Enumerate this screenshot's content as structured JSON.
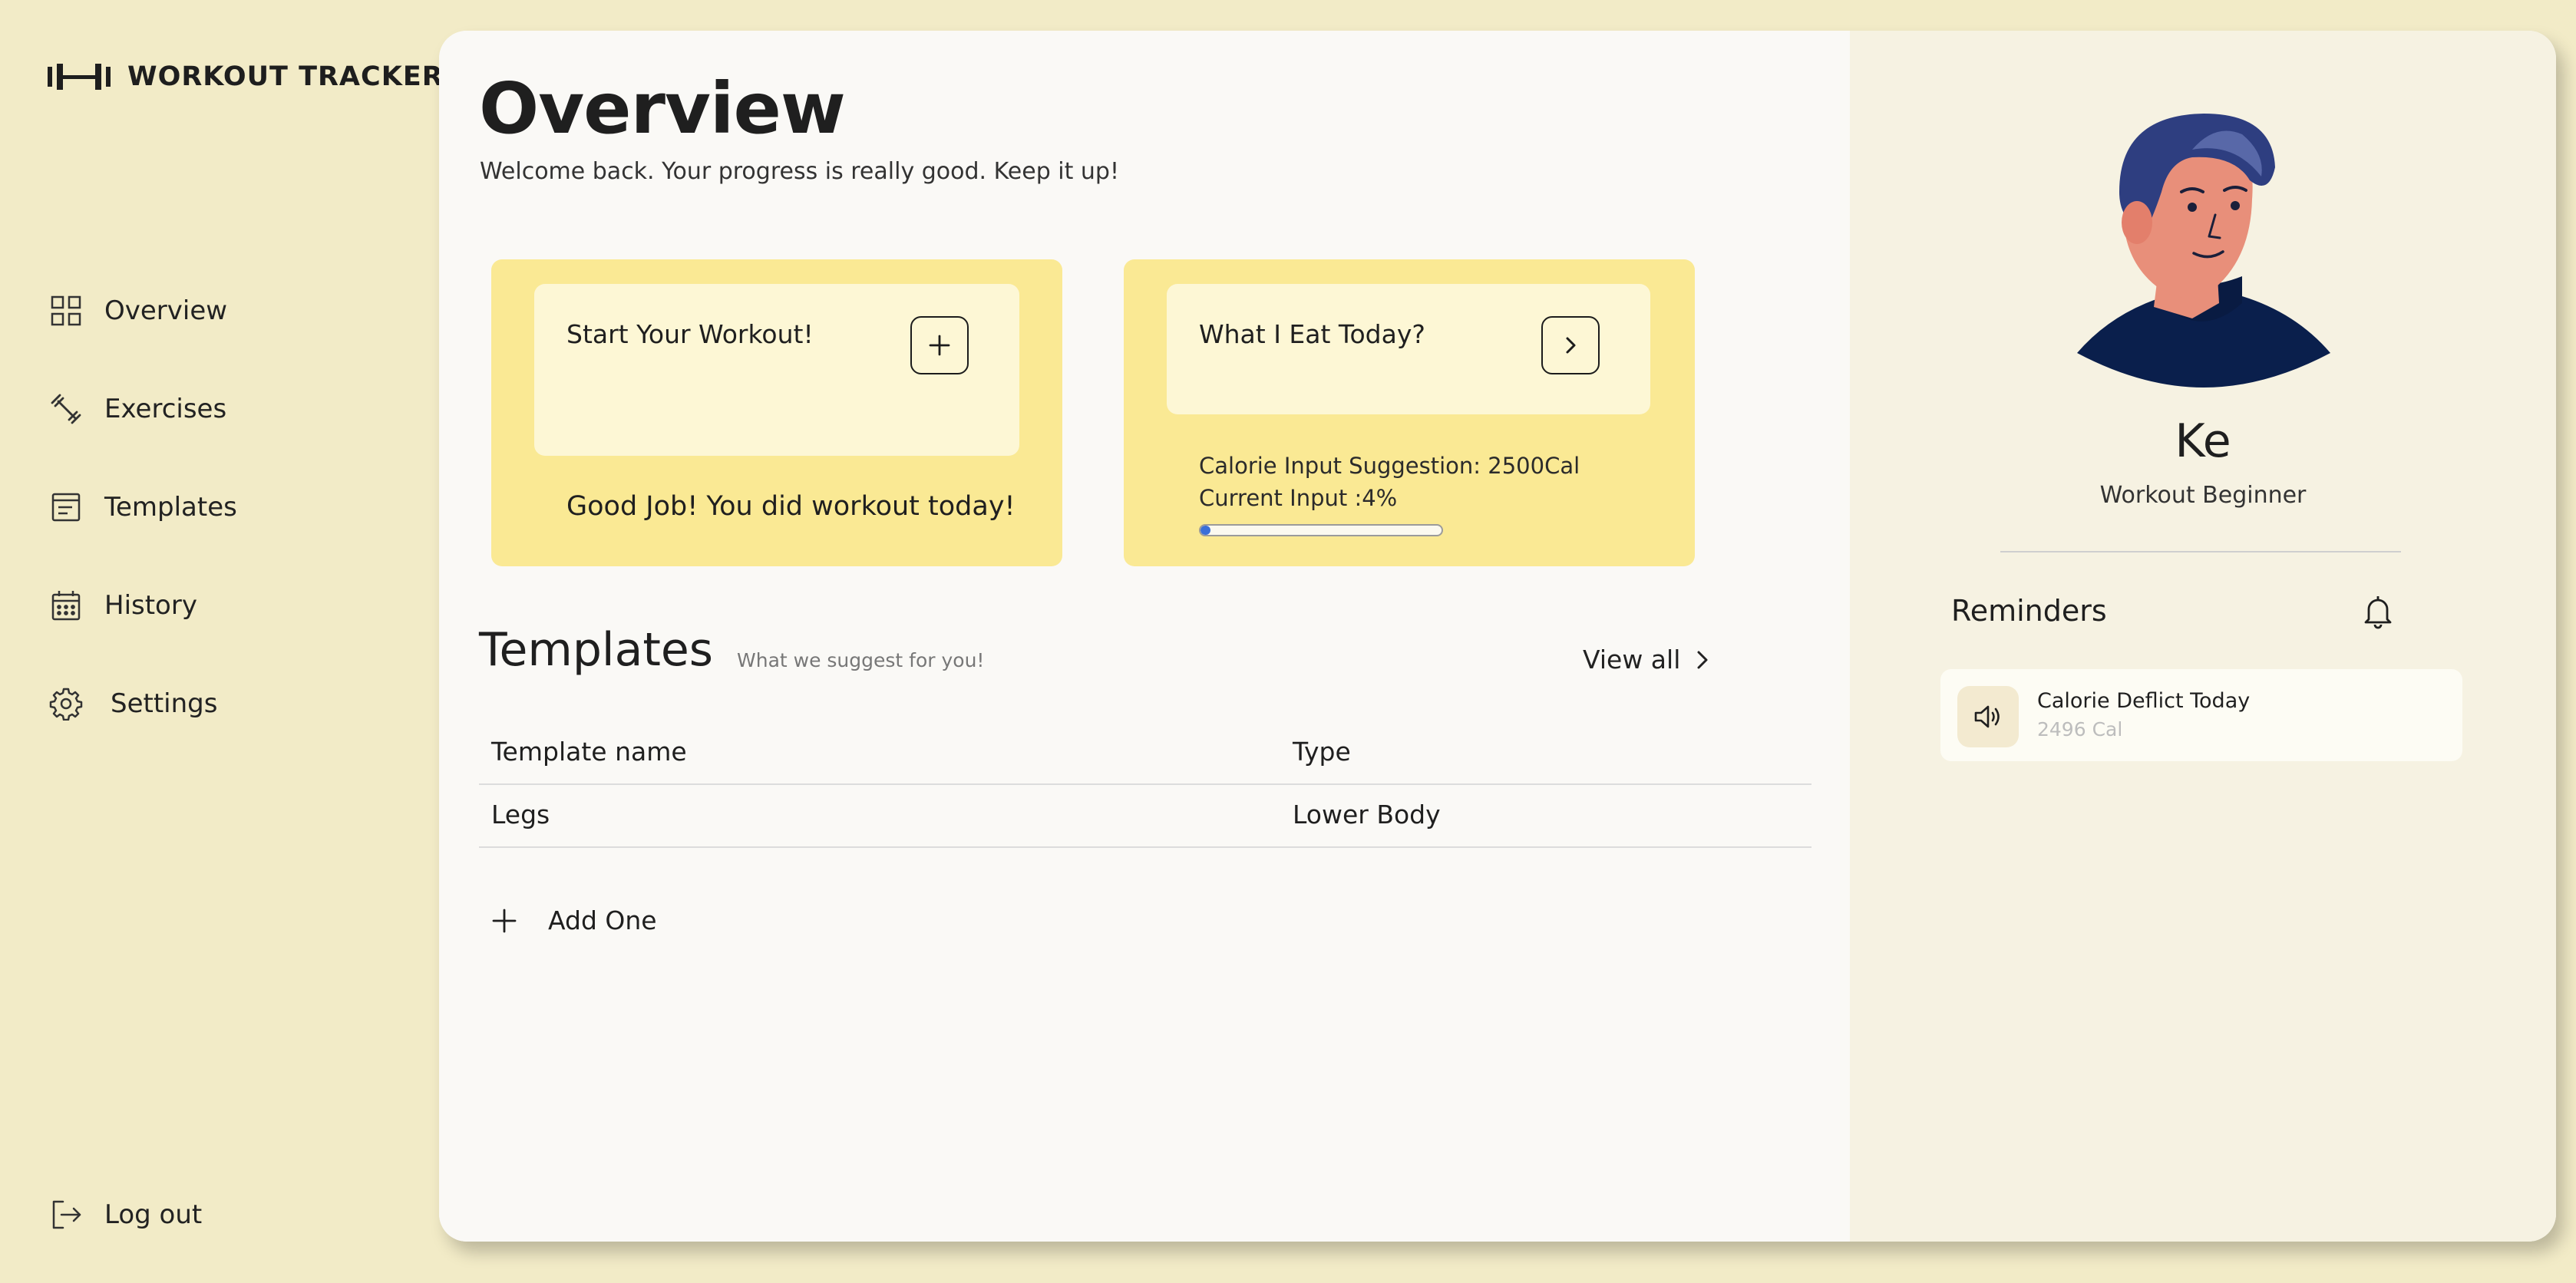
{
  "app": {
    "title": "WORKOUT TRACKER"
  },
  "sidebar": {
    "items": [
      {
        "label": "Overview",
        "icon": "grid-icon"
      },
      {
        "label": "Exercises",
        "icon": "dumbbell-icon"
      },
      {
        "label": "Templates",
        "icon": "template-icon"
      },
      {
        "label": "History",
        "icon": "calendar-icon"
      },
      {
        "label": "Settings",
        "icon": "gear-icon"
      }
    ],
    "logout": {
      "label": "Log out",
      "icon": "logout-icon"
    }
  },
  "overview": {
    "title": "Overview",
    "subtitle": "Welcome back. Your progress is really good. Keep it up!",
    "workout_card": {
      "title": "Start Your Workout!",
      "action_icon": "plus-icon",
      "message": "Good Job! You did workout today!"
    },
    "food_card": {
      "title": "What I Eat Today?",
      "action_icon": "chevron-right-icon",
      "suggestion": "Calorie Input Suggestion: 2500Cal",
      "current": "Current Input :4%",
      "progress_percent": 4
    }
  },
  "templates": {
    "title": "Templates",
    "subtitle": "What we suggest for you!",
    "view_all": "View all",
    "columns": [
      "Template name",
      "Type"
    ],
    "rows": [
      {
        "name": "Legs",
        "type": "Lower Body"
      }
    ],
    "add_label": "Add One"
  },
  "profile": {
    "name": "Ke",
    "role": "Workout Beginner"
  },
  "reminders": {
    "title": "Reminders",
    "items": [
      {
        "label": "Calorie Deflict Today",
        "value": "2496 Cal",
        "icon": "speaker-icon"
      }
    ]
  },
  "colors": {
    "background": "#f2ebc7",
    "card": "#fae994",
    "card_inner": "#fdf7d5",
    "main_panel": "#faf9f6",
    "right_panel": "#f6f2e2",
    "progress_fill": "#3b6fd8"
  }
}
